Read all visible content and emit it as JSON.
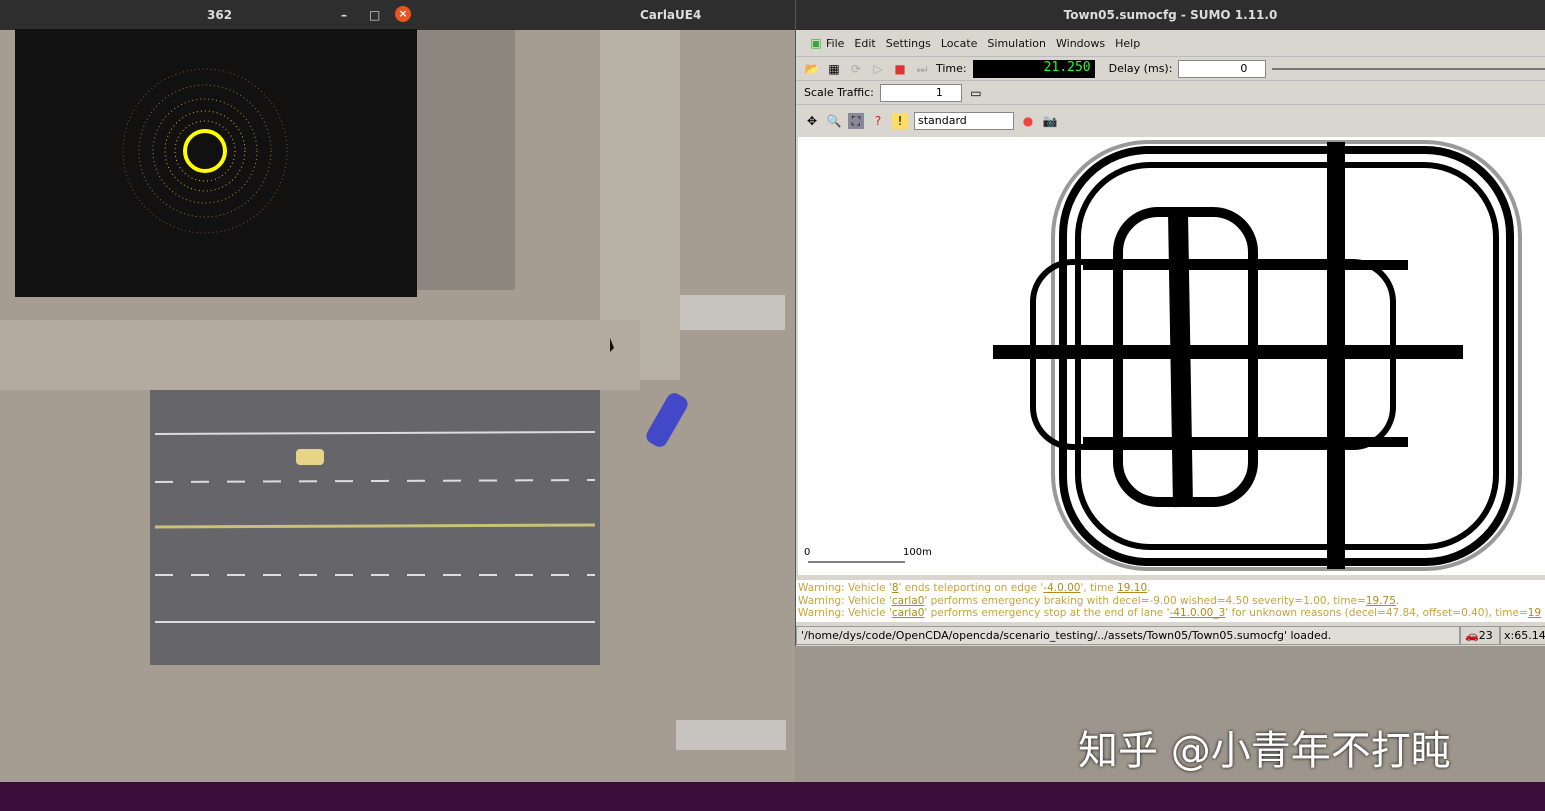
{
  "desktop": {
    "title": "CarlaUE4"
  },
  "lidar_window": {
    "title": "362"
  },
  "sumo": {
    "title": "Town05.sumocfg - SUMO 1.11.0",
    "menu": [
      "File",
      "Edit",
      "Settings",
      "Locate",
      "Simulation",
      "Windows",
      "Help"
    ],
    "time_label": "Time:",
    "time_value": "21.250",
    "delay_label": "Delay (ms):",
    "delay_value": "0",
    "scale_label": "Scale Traffic:",
    "scale_value": "1",
    "scheme": "standard",
    "scale_bar": {
      "start": "0",
      "end": "100m"
    },
    "messages": [
      {
        "pre": "Warning: Vehicle '",
        "a": "8",
        "mid": "' ends teleporting on edge '",
        "b": "-4.0.00",
        "post": "', time ",
        "c": "19.10",
        "end": "."
      },
      {
        "pre": "Warning: Vehicle '",
        "a": "carla0",
        "mid": "' performs emergency braking with decel=-9.00 wished=4.50 severity=1.00, time=",
        "b": "19.75",
        "post": ".",
        "c": "",
        "end": ""
      },
      {
        "pre": "Warning: Vehicle '",
        "a": "carla0",
        "mid": "' performs emergency stop at the end of lane '",
        "b": "-41.0.00_3",
        "post": "' for unknown reasons (decel=47.84, offset=0.40), time=",
        "c": "19",
        "end": ""
      }
    ],
    "status_path": "'/home/dys/code/OpenCDA/opencda/scenario_testing/../assets/Town05/Town05.sumocfg' loaded.",
    "vehicle_count": "23",
    "coord": "x:65.14"
  },
  "watermark": "知乎 @小青年不打盹"
}
